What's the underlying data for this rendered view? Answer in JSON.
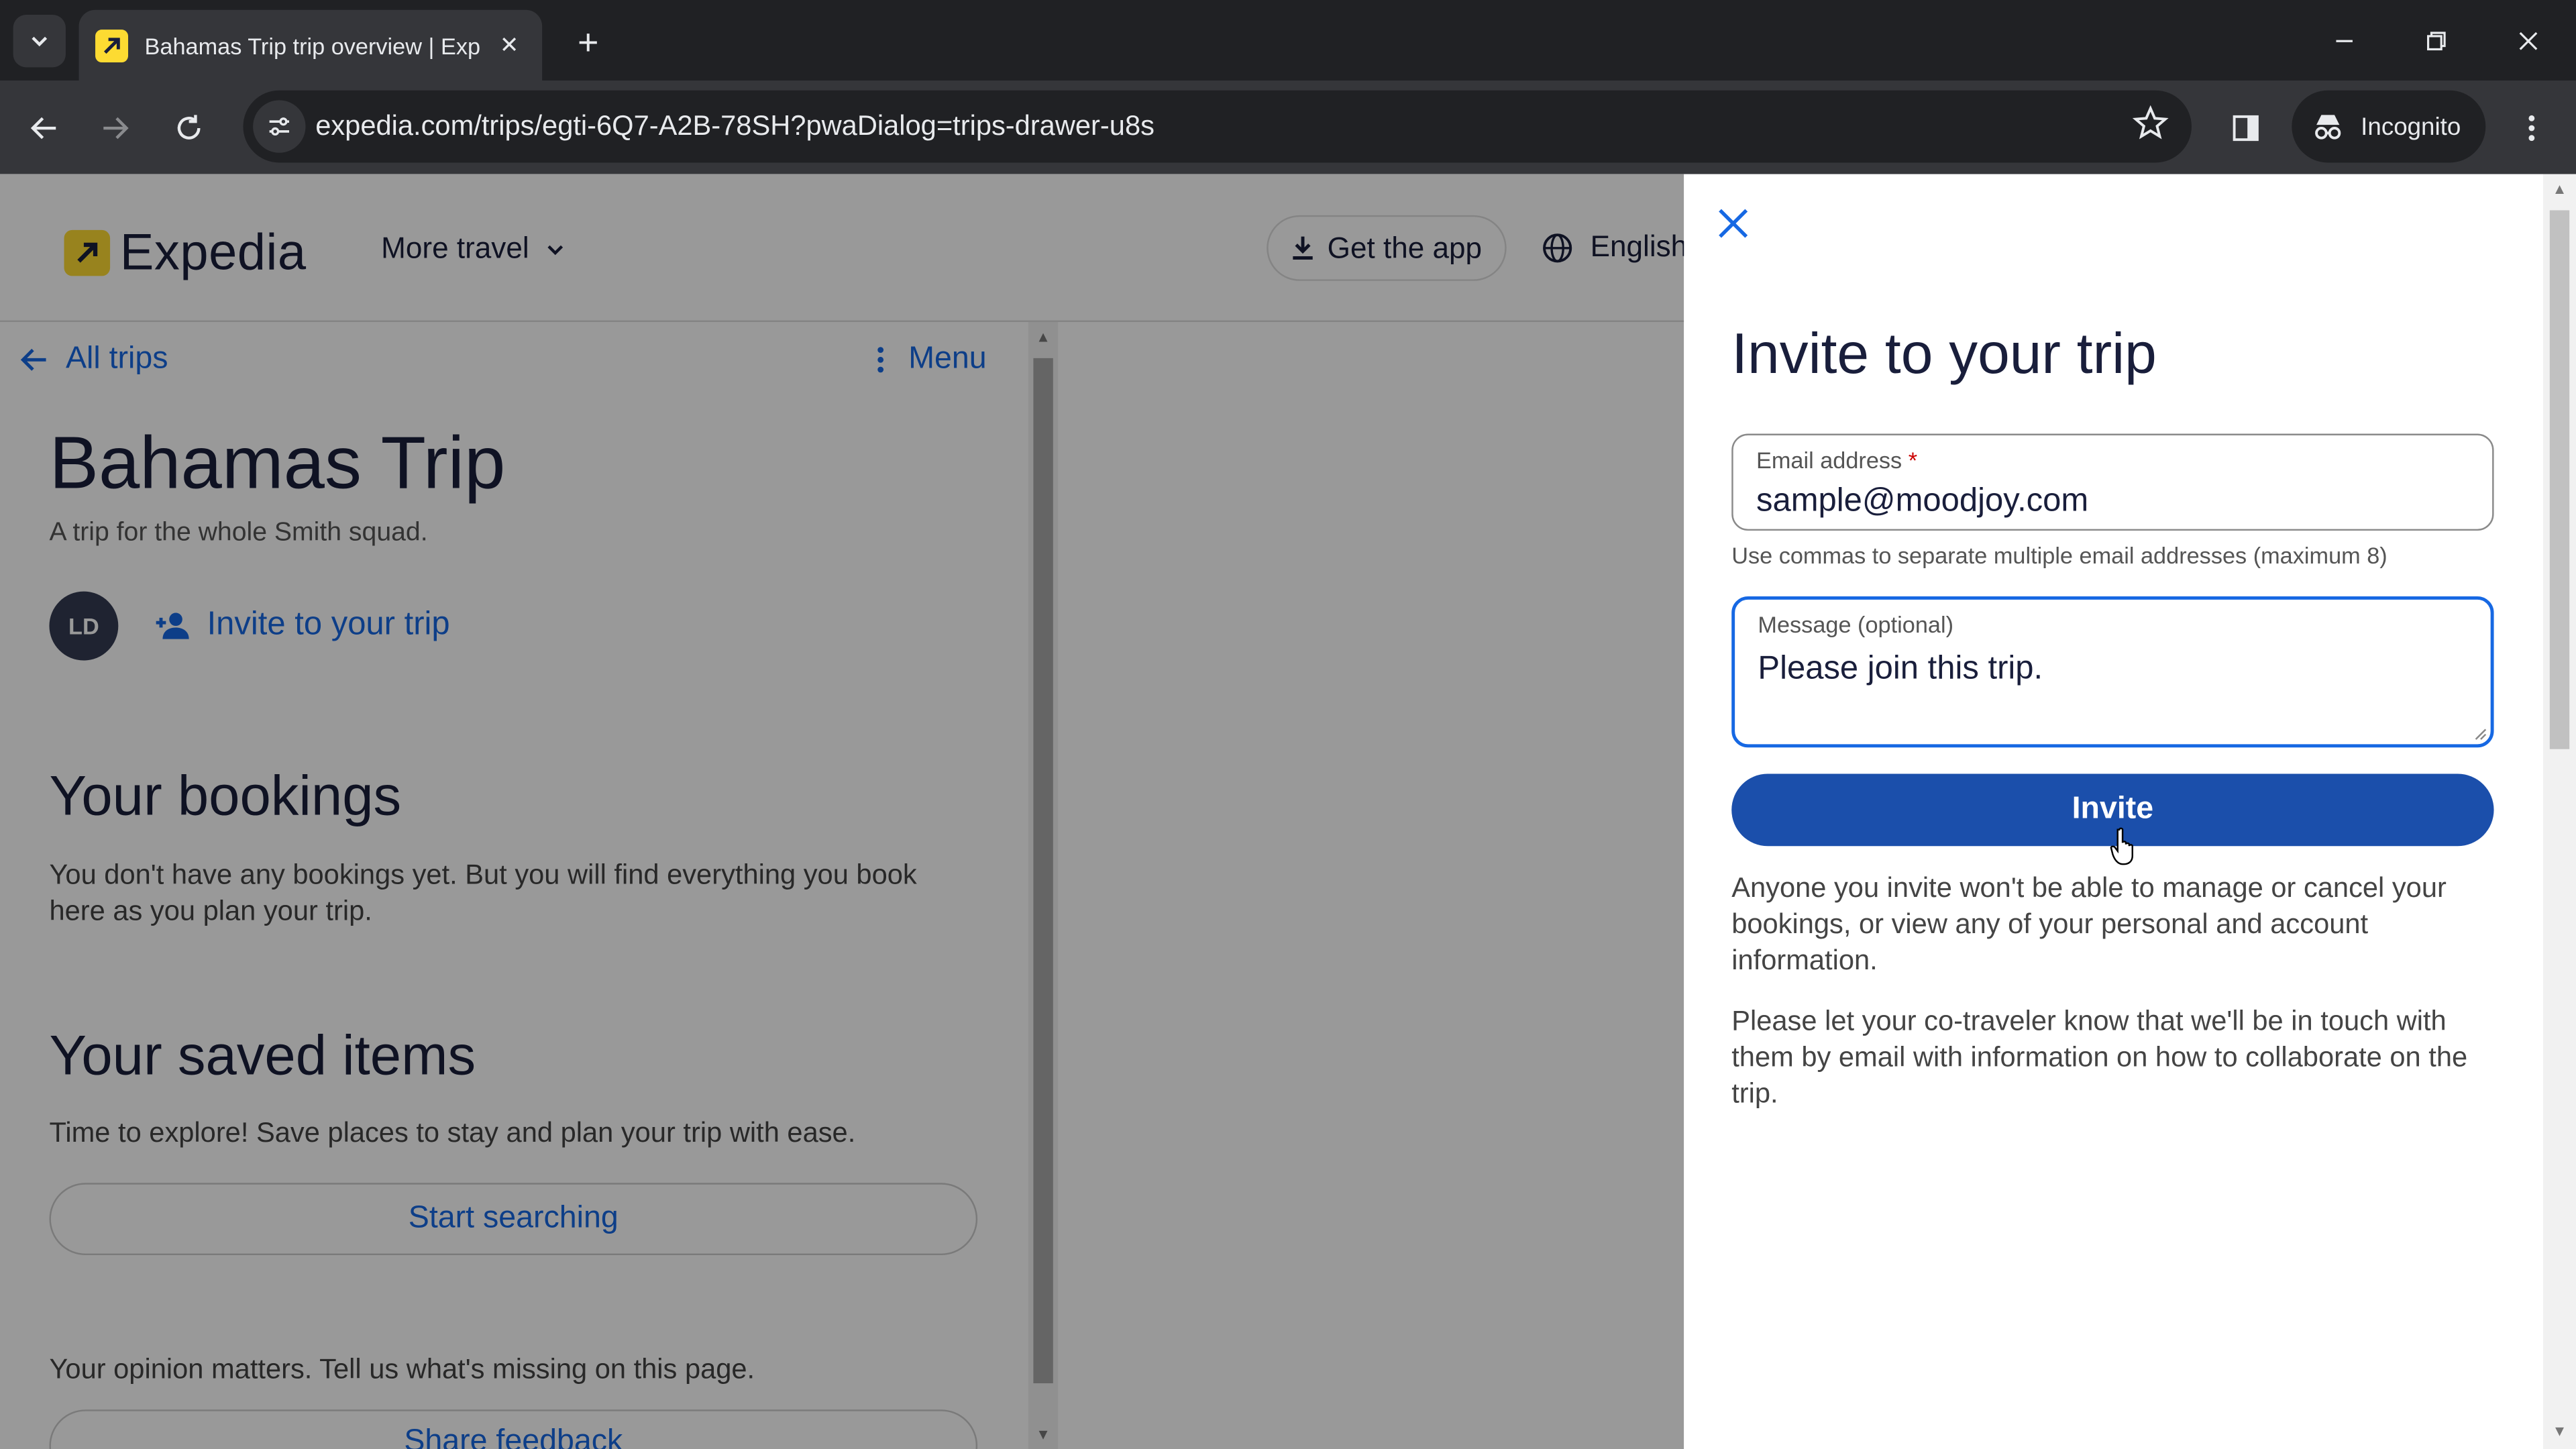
{
  "browser": {
    "tab_title": "Bahamas Trip trip overview | Exp",
    "url": "expedia.com/trips/egti-6Q7-A2B-78SH?pwaDialog=trips-drawer-u8s",
    "incognito_label": "Incognito"
  },
  "header": {
    "logo_text": "Expedia",
    "more_travel": "More travel",
    "get_app": "Get the app",
    "language": "English"
  },
  "trip": {
    "back_label": "All trips",
    "menu_label": "Menu",
    "title": "Bahamas Trip",
    "subtitle": "A trip for the whole Smith squad.",
    "avatar_initials": "LD",
    "invite_link": "Invite to your trip",
    "bookings_heading": "Your bookings",
    "bookings_text": "You don't have any bookings yet. But you will find everything you book here as you plan your trip.",
    "saved_heading": "Your saved items",
    "saved_text": "Time to explore! Save places to stay and plan your trip with ease.",
    "start_searching": "Start searching",
    "opinion_text": "Your opinion matters. Tell us what's missing on this page.",
    "share_feedback": "Share feedback"
  },
  "drawer": {
    "title": "Invite to your trip",
    "email_label": "Email address",
    "email_required": "*",
    "email_value": "sample@moodjoy.com",
    "email_helper": "Use commas to separate multiple email addresses (maximum 8)",
    "message_label": "Message (optional)",
    "message_value": "Please join this trip.",
    "invite_button": "Invite",
    "disclaimer_1": "Anyone you invite won't be able to manage or cancel your bookings, or view any of your personal and account information.",
    "disclaimer_2": "Please let your co-traveler know that we'll be in touch with them by email with information on how to collaborate on the trip."
  },
  "colors": {
    "brand_blue": "#1668e3",
    "invite_button": "#1b4fab",
    "logo_yellow": "#fddb32"
  }
}
